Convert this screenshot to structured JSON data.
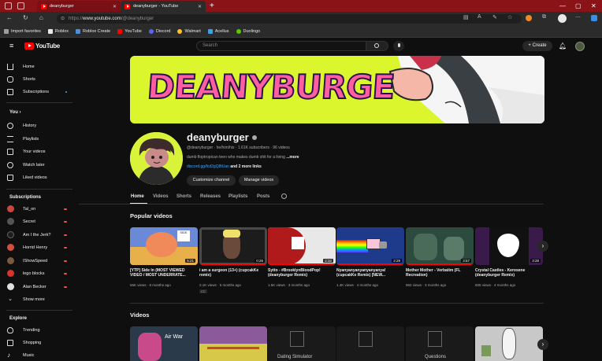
{
  "browser": {
    "tabs": [
      {
        "title": "deanyburger",
        "active": false
      },
      {
        "title": "deanyburger - YouTube",
        "active": true
      }
    ],
    "url_prefix": "https://",
    "url_host": "www.youtube.com",
    "url_path": "/@deanyburger",
    "bookmarks": [
      {
        "label": "Import favorites",
        "color": "#9e9e9e"
      },
      {
        "label": "Roblox",
        "color": "#e8e8e8"
      },
      {
        "label": "Roblox Create",
        "color": "#4a90d9"
      },
      {
        "label": "YouTube",
        "color": "#ff0000"
      },
      {
        "label": "Discord",
        "color": "#5865f2"
      },
      {
        "label": "Walmart",
        "color": "#ffc220"
      },
      {
        "label": "Acellus",
        "color": "#3aa0e8"
      },
      {
        "label": "Duolingo",
        "color": "#58cc02"
      }
    ]
  },
  "yt": {
    "logo": "YouTube",
    "search_placeholder": "Search",
    "create_label": "Create"
  },
  "sidebar": {
    "main": [
      "Home",
      "Shorts",
      "Subscriptions"
    ],
    "you_heading": "You",
    "you": [
      "History",
      "Playlists",
      "Your videos",
      "Watch later",
      "Liked videos"
    ],
    "subs_heading": "Subscriptions",
    "subs": [
      {
        "name": "Tal_on",
        "color": "#c9463d"
      },
      {
        "name": "Secret",
        "color": "#555555"
      },
      {
        "name": "Am I the Jerk?",
        "color": "#1d1d1d"
      },
      {
        "name": "Horrid Henry",
        "color": "#d64d3a"
      },
      {
        "name": "IShowSpeed",
        "color": "#7a5a3a"
      },
      {
        "name": "lego blocks",
        "color": "#d9332b"
      },
      {
        "name": "Alan Becker",
        "color": "#e0e0e0"
      }
    ],
    "show_more": "Show more",
    "explore_heading": "Explore",
    "explore": [
      "Trending",
      "Shopping",
      "Music"
    ]
  },
  "channel": {
    "banner_text": "DEANYBURGE",
    "name": "deanyburger",
    "meta": "@deanyburger · he/him/his · 1.61K subscribers · 96 videos",
    "description": "dumb floptropican teen who makes dumb shit for a living",
    "more": "...more",
    "link": "discord.gg/fcd2gQ8tUan",
    "more_links": "and 2 more links",
    "customize_label": "Customize channel",
    "manage_label": "Manage videos",
    "tabs": [
      "Home",
      "Videos",
      "Shorts",
      "Releases",
      "Playlists",
      "Posts"
    ]
  },
  "popular": {
    "heading": "Popular videos",
    "videos": [
      {
        "title": "[YTP] Side In (MOST VIEWED VIDEO / MOST UNDERRATE...",
        "meta": "66K views · 8 months ago",
        "duration": "5:21",
        "thumb": "#6a8ad8"
      },
      {
        "title": "i am a surgeon (13+) (cupcakKe remix)",
        "meta": "2.1K views · 5 months ago",
        "duration": "0:26",
        "thumb": "#4a4a4a",
        "badge": "CC"
      },
      {
        "title": "Sytto - #BrooklynBloodPop! (deanyburger Remix)",
        "meta": "1.5K views · 3 months ago",
        "duration": "2:32",
        "thumb": "#e8e8e8"
      },
      {
        "title": "Nyanyanyanyanyanyanya! (cupcakKe Remix) [NEW...",
        "meta": "1.4K views · 4 months ago",
        "duration": "2:29",
        "thumb": "#1e3a8a"
      },
      {
        "title": "Mother Mother - Verbatim (FL Recreation)",
        "meta": "962 views · 3 months ago",
        "duration": "3:57",
        "thumb": "#2d4a3e"
      },
      {
        "title": "Crystal Castles - Kerosene (deanyburger Remix)",
        "meta": "605 views · 4 months ago",
        "duration": "3:28",
        "thumb": "#3a1a4a"
      }
    ]
  },
  "videos_section": {
    "heading": "Videos",
    "thumbs": [
      {
        "label": "Air War",
        "color": "#2a3a4a"
      },
      {
        "label": "",
        "color": "#8a5a9a"
      },
      {
        "label": "Dating Simulator",
        "color": "#1a1a1a"
      },
      {
        "label": "",
        "color": "#1a1a1a"
      },
      {
        "label": "Questions",
        "color": "#1a1a1a"
      },
      {
        "label": "",
        "color": "#c8c8c8"
      }
    ]
  }
}
